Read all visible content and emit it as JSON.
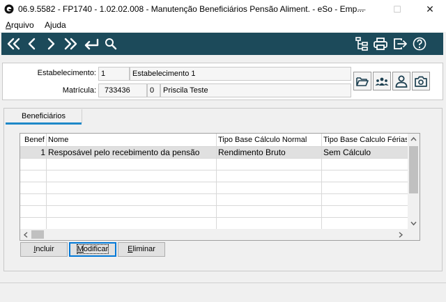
{
  "window": {
    "title": "06.9.5582 - FP1740 - 1.02.02.008 - Manutenção Beneficiários Pensão Aliment. - eSo - Emp...",
    "minimize_glyph": "—",
    "maximize_glyph": "☐",
    "close_glyph": "✕"
  },
  "menu": {
    "arquivo_first": "A",
    "arquivo_rest": "rquivo",
    "ajuda_first": "A",
    "ajuda_u": "j",
    "ajuda_rest": "uda"
  },
  "toolbar": {
    "left_icons": [
      "first-icon",
      "previous-icon",
      "next-icon",
      "last-icon",
      "enter-icon",
      "search-icon"
    ],
    "right_icons": [
      "tree-icon",
      "print-icon",
      "exit-icon",
      "help-icon"
    ],
    "color": "#1c4a5a"
  },
  "header": {
    "estabelecimento_label": "Estabelecimento:",
    "estabelecimento_code": "1",
    "estabelecimento_name": "Estabelecimento 1",
    "matricula_label": "Matrícula:",
    "matricula_value": "733436",
    "matricula_digit": "0",
    "employee_name": "Priscila Teste",
    "side_icons": [
      "folder-open-icon",
      "group-icon",
      "person-icon",
      "camera-icon"
    ]
  },
  "tabs": [
    {
      "label": "Beneficiários",
      "active": true
    }
  ],
  "grid": {
    "columns": [
      "Benef",
      "Nome",
      "Tipo Base Cálculo Normal",
      "Tipo Base Calculo Férias"
    ],
    "rows": [
      {
        "benef": "1",
        "nome": "Resposável pelo recebimento da pensão",
        "tipo_normal": "Rendimento Bruto",
        "tipo_ferias": "Sem Cálculo"
      }
    ]
  },
  "buttons": {
    "incluir_first": "I",
    "incluir_rest": "ncluir",
    "modificar_first": "M",
    "modificar_rest": "odificar",
    "eliminar_first": "E",
    "eliminar_rest": "liminar"
  },
  "colors": {
    "tab_accent": "#1e88c8",
    "focus_border": "#0078d7"
  }
}
